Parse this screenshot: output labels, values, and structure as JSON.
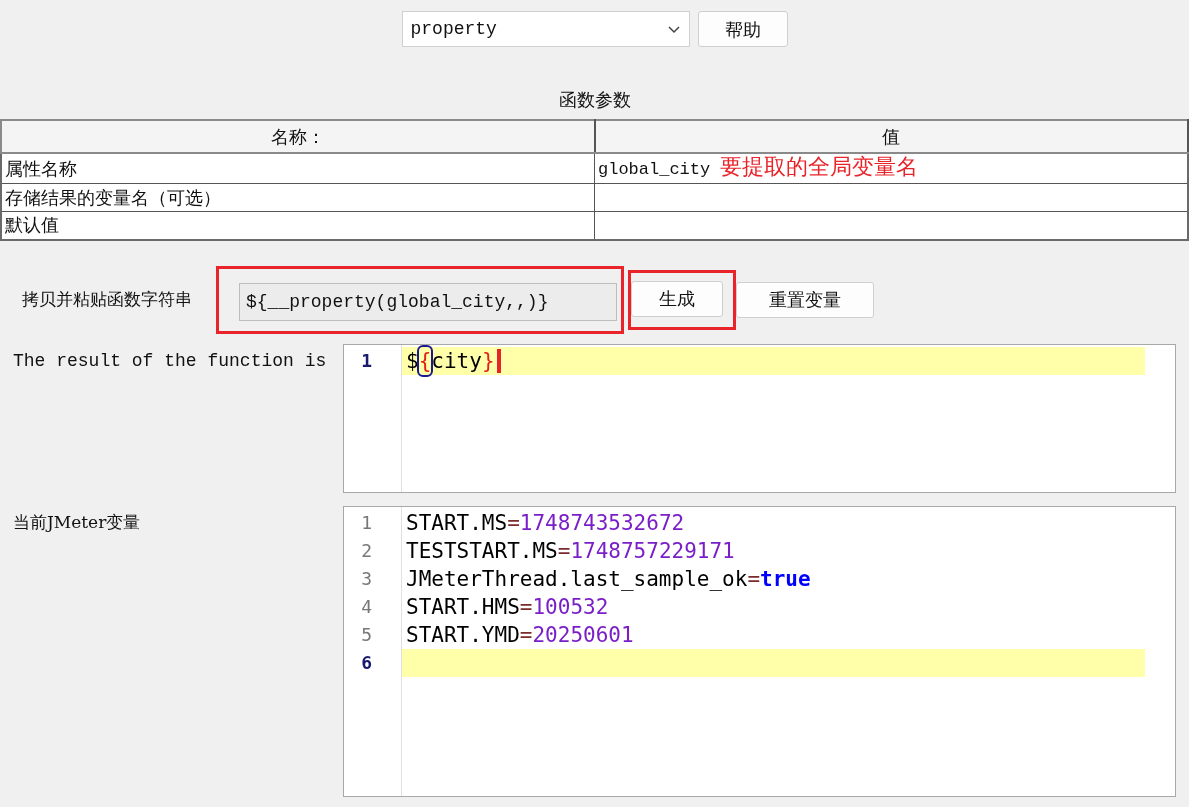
{
  "function_select": {
    "value": "property"
  },
  "help_button": "帮助",
  "params_title": "函数参数",
  "params_table": {
    "columns": [
      "名称：",
      "值"
    ],
    "rows": [
      {
        "name": "属性名称",
        "value": "global_city",
        "annotation": "要提取的全局变量名"
      },
      {
        "name": "存储结果的变量名（可选）",
        "value": ""
      },
      {
        "name": "默认值",
        "value": ""
      }
    ]
  },
  "function_string": {
    "label": "拷贝并粘贴函数字符串",
    "value": "${__property(global_city,,)}",
    "annotated": true
  },
  "generate_button": {
    "label": "生成",
    "annotated": true
  },
  "reset_button": {
    "label": "重置变量"
  },
  "result": {
    "label": "The result of the function is",
    "lines": [
      {
        "number": "1",
        "current": true,
        "caret": true,
        "tokens": [
          {
            "kind": "plain",
            "text": "$"
          },
          {
            "kind": "brace_match",
            "text": "{"
          },
          {
            "kind": "plain",
            "text": "city"
          },
          {
            "kind": "brace_open",
            "text": "}"
          }
        ]
      }
    ]
  },
  "variables": {
    "label": "当前JMeter变量",
    "lines": [
      {
        "number": "1",
        "current": false,
        "caret": false,
        "tokens": [
          {
            "kind": "key",
            "text": "START.MS"
          },
          {
            "kind": "op",
            "text": "="
          },
          {
            "kind": "number",
            "text": "1748743532672"
          }
        ]
      },
      {
        "number": "2",
        "current": false,
        "caret": false,
        "tokens": [
          {
            "kind": "key",
            "text": "TESTSTART.MS"
          },
          {
            "kind": "op",
            "text": "="
          },
          {
            "kind": "number",
            "text": "1748757229171"
          }
        ]
      },
      {
        "number": "3",
        "current": false,
        "caret": false,
        "tokens": [
          {
            "kind": "key",
            "text": "JMeterThread.last_sample_ok"
          },
          {
            "kind": "op",
            "text": "="
          },
          {
            "kind": "keyword",
            "text": "true"
          }
        ]
      },
      {
        "number": "4",
        "current": false,
        "caret": false,
        "tokens": [
          {
            "kind": "key",
            "text": "START.HMS"
          },
          {
            "kind": "op",
            "text": "="
          },
          {
            "kind": "number",
            "text": "100532"
          }
        ]
      },
      {
        "number": "5",
        "current": false,
        "caret": false,
        "tokens": [
          {
            "kind": "key",
            "text": "START.YMD"
          },
          {
            "kind": "op",
            "text": "="
          },
          {
            "kind": "number",
            "text": "20250601"
          }
        ]
      },
      {
        "number": "6",
        "current": true,
        "caret": false
      }
    ]
  }
}
